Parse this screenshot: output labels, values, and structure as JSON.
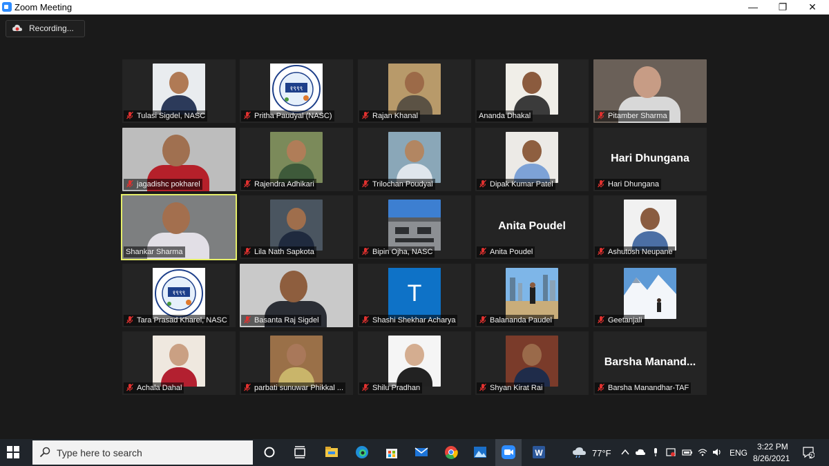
{
  "window": {
    "title": "Zoom Meeting",
    "controls": {
      "minimize": "—",
      "maximize": "❐",
      "close": "✕"
    }
  },
  "meeting": {
    "recording_label": "Recording...",
    "participants": [
      {
        "name": "Tulasi Sigdel, NASC",
        "muted": true,
        "kind": "photo",
        "skin": "#b07a55",
        "shirt": "#2c3a5a",
        "bg": "#e9ecef"
      },
      {
        "name": "Pritha Paudyal (NASC)",
        "muted": true,
        "kind": "logo"
      },
      {
        "name": "Rajan Khanal",
        "muted": true,
        "kind": "photo",
        "skin": "#9c6a48",
        "shirt": "#5b5244",
        "bg": "#b89a6a"
      },
      {
        "name": "Ananda Dhakal",
        "muted": false,
        "kind": "photo",
        "skin": "#8b5b3e",
        "shirt": "#3b3b3b",
        "bg": "#f0eee8"
      },
      {
        "name": "Pitamber Sharma",
        "muted": true,
        "kind": "wide",
        "skin": "#c79c85",
        "shirt": "#d8d8d8",
        "bg": "#6a6058"
      },
      {
        "name": "jagadishc pokharel",
        "muted": true,
        "kind": "wide",
        "skin": "#a07050",
        "shirt": "#b5202a",
        "bg": "#bdbdbd"
      },
      {
        "name": "Rajendra Adhikari",
        "muted": true,
        "kind": "photo",
        "skin": "#b07d58",
        "shirt": "#3e5a3a",
        "bg": "#7b8a5a"
      },
      {
        "name": "Trilochan Poudyal",
        "muted": true,
        "kind": "photo",
        "skin": "#b28662",
        "shirt": "#dfe6ec",
        "bg": "#8aa7b8"
      },
      {
        "name": "Dipak Kumar Patel",
        "muted": true,
        "kind": "photo",
        "skin": "#8e5f40",
        "shirt": "#7da2d6",
        "bg": "#eceae6"
      },
      {
        "name": "Hari Dhungana",
        "muted": true,
        "kind": "name",
        "display": "Hari Dhungana"
      },
      {
        "name": "Shankar Sharma",
        "muted": false,
        "kind": "wide",
        "skin": "#a36f4e",
        "shirt": "#e2dfe6",
        "bg": "#7d7f80",
        "active": true
      },
      {
        "name": "Lila Nath Sapkota",
        "muted": true,
        "kind": "photo",
        "skin": "#9f6e4c",
        "shirt": "#1f2a3e",
        "bg": "#4a5560"
      },
      {
        "name": "Bipin Ojha, NASC",
        "muted": true,
        "kind": "building"
      },
      {
        "name": "Anita Poudel",
        "muted": true,
        "kind": "name",
        "display": "Anita Poudel"
      },
      {
        "name": "Ashutosh Neupane",
        "muted": true,
        "kind": "photo",
        "skin": "#8a5c40",
        "shirt": "#4b6fa5",
        "bg": "#f1f1f1"
      },
      {
        "name": "Tara Prasad Kharel, NASC",
        "muted": true,
        "kind": "logo"
      },
      {
        "name": "Basanta Raj Sigdel",
        "muted": true,
        "kind": "wide",
        "skin": "#8e5e3e",
        "shirt": "#2b2e35",
        "bg": "#c9c9c9"
      },
      {
        "name": "Shashi Shekhar Acharya",
        "muted": true,
        "kind": "letter",
        "display": "T"
      },
      {
        "name": "Balananda Paudel",
        "muted": true,
        "kind": "city"
      },
      {
        "name": "Geetanjali",
        "muted": true,
        "kind": "snow"
      },
      {
        "name": "Achala Dahal",
        "muted": true,
        "kind": "photo",
        "skin": "#caa083",
        "shirt": "#b32030",
        "bg": "#efe8df"
      },
      {
        "name": "parbati sunuwar Phikkal ...",
        "muted": true,
        "kind": "photo",
        "skin": "#a9785a",
        "shirt": "#c9b56a",
        "bg": "#9a7048"
      },
      {
        "name": "Shilu Pradhan",
        "muted": true,
        "kind": "photo",
        "skin": "#d4ad90",
        "shirt": "#222222",
        "bg": "#f5f5f5"
      },
      {
        "name": "Shyan Kirat Rai",
        "muted": true,
        "kind": "photo",
        "skin": "#9a6a4a",
        "shirt": "#1f2c4a",
        "bg": "#7a3b2a"
      },
      {
        "name": "Barsha Manandhar-TAF",
        "muted": true,
        "kind": "name",
        "display": "Barsha  Manand..."
      }
    ],
    "logo_text": "१९९९"
  },
  "taskbar": {
    "search_placeholder": "Type here to search",
    "weather": "77°F",
    "language": "ENG",
    "time": "3:22 PM",
    "date": "8/26/2021",
    "notification_count": "2",
    "app_icons": [
      "cortana-icon",
      "task-view-icon",
      "file-explorer-icon",
      "edge-icon",
      "store-icon",
      "mail-icon",
      "chrome-icon",
      "photos-icon",
      "zoom-icon",
      "word-icon"
    ]
  }
}
